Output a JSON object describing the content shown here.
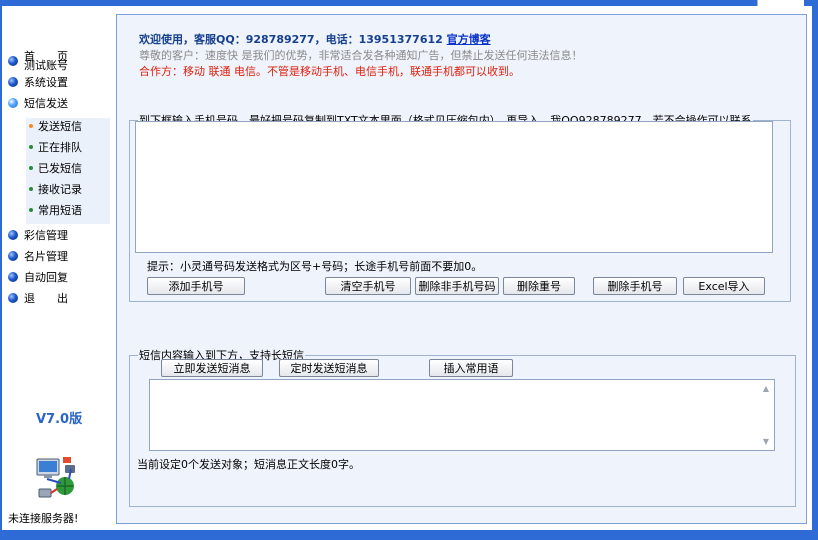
{
  "sidebar": {
    "nav": [
      {
        "label": "首　　页",
        "sub_label": "测试账号"
      },
      {
        "label": "系统设置"
      },
      {
        "label": "短信发送"
      },
      {
        "label": "彩信管理"
      },
      {
        "label": "名片管理"
      },
      {
        "label": "自动回复"
      },
      {
        "label": "退　　出"
      }
    ],
    "submenu": [
      "发送短信",
      "正在排队",
      "已发短信",
      "接收记录",
      "常用短语"
    ],
    "active_submenu": "发送短信",
    "version": "V7.0版",
    "server_status": "未连接服务器!"
  },
  "notice": {
    "line1": "欢迎使用，客服QQ：928789277，电话：13951377612",
    "blog_link": "官方博客",
    "line2": "尊敬的客户：速度快 是我们的优势，非常适合发各种通知广告，但禁止发送任何违法信息！",
    "line3": "合作方：移动 联通 电信。不管是移动手机、电信手机，联通手机都可以收到。"
  },
  "phones": {
    "legend": "到下框输入手机号码，最好把号码复制到TXT文本里面（格式见压缩包内），再导入，我QQ928789277，若不会操作可以联系",
    "value": "",
    "tip": "提示：小灵通号码发送格式为区号+号码；长途手机号前面不要加0。",
    "buttons": {
      "add": "添加手机号",
      "clear": "清空手机号",
      "delete_invalid": "删除非手机号码",
      "delete_duplicates": "删除重号",
      "delete": "删除手机号",
      "excel_import": "Excel导入"
    }
  },
  "content": {
    "legend": "短信内容输入到下方，支持长短信",
    "buttons": {
      "send_now": "立即发送短消息",
      "send_scheduled": "定时发送短消息",
      "insert_phrase": "插入常用语"
    },
    "value": "",
    "status": "当前设定0个发送对象；短消息正文长度0字。"
  },
  "colors": {
    "frame": "#2f6bd6",
    "panel_bg": "#eef3fc",
    "link": "#0b35c9",
    "alert_red": "#e0200c",
    "version_blue": "#2a64c8"
  }
}
